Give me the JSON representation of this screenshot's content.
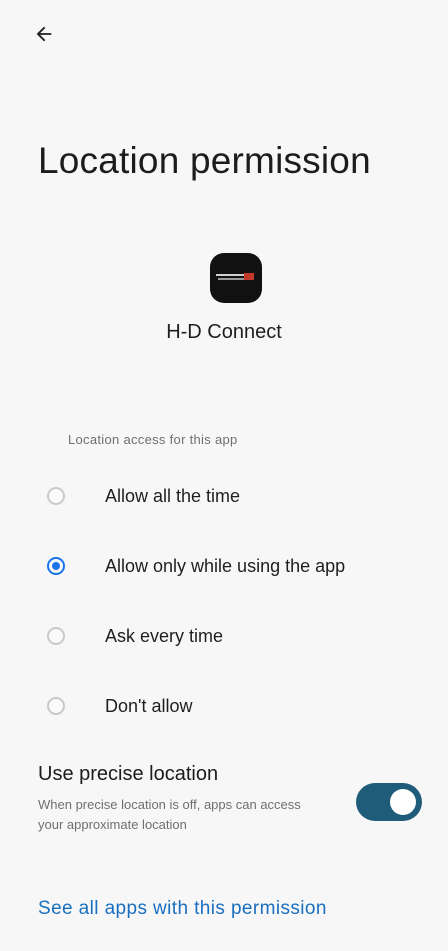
{
  "header": {
    "back_icon": "arrow-left-icon"
  },
  "title": "Location permission",
  "app": {
    "name": "H-D Connect",
    "icon": "harley-davidson-app-icon"
  },
  "section_label": "Location access for this app",
  "options": [
    {
      "label": "Allow all the time",
      "selected": false
    },
    {
      "label": "Allow only while using the app",
      "selected": true
    },
    {
      "label": "Ask every time",
      "selected": false
    },
    {
      "label": "Don't allow",
      "selected": false
    }
  ],
  "precise": {
    "title": "Use precise location",
    "description": "When precise location is off, apps can access your approximate location",
    "enabled": true
  },
  "link": "See all apps with this permission",
  "colors": {
    "accent": "#1a73e8",
    "toggle": "#1f5c7a",
    "link": "#1a6fbf"
  }
}
